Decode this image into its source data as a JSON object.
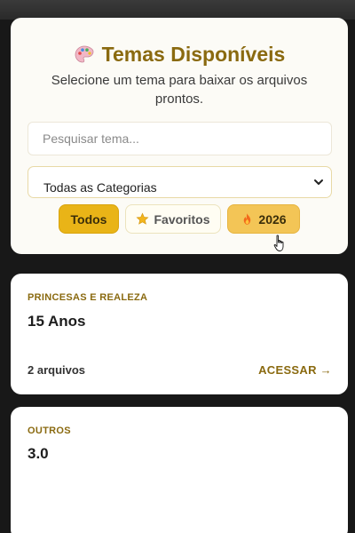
{
  "header": {
    "title": "Temas Disponíveis",
    "subtitle": "Selecione um tema para baixar os arquivos prontos.",
    "title_icon": "palette-icon"
  },
  "search": {
    "placeholder": "Pesquisar tema...",
    "value": ""
  },
  "category_select": {
    "selected": "Todas as Categorias",
    "icon": "chevron-down-icon"
  },
  "filters": [
    {
      "label": "Todos",
      "icon": "",
      "active": true
    },
    {
      "label": "Favoritos",
      "icon": "star-icon",
      "active": false
    },
    {
      "label": "2026",
      "icon": "fire-icon",
      "active": false
    }
  ],
  "themes": [
    {
      "category": "PRINCESAS E REALEZA",
      "title": "15 Anos",
      "files": "2 arquivos",
      "action": "ACESSAR →"
    },
    {
      "category": "OUTROS",
      "title": "3.0"
    }
  ],
  "colors": {
    "accent": "#8a6a10",
    "active_pill": "#e9b417",
    "highlight_pill": "#f3c556",
    "background": "#181818"
  }
}
